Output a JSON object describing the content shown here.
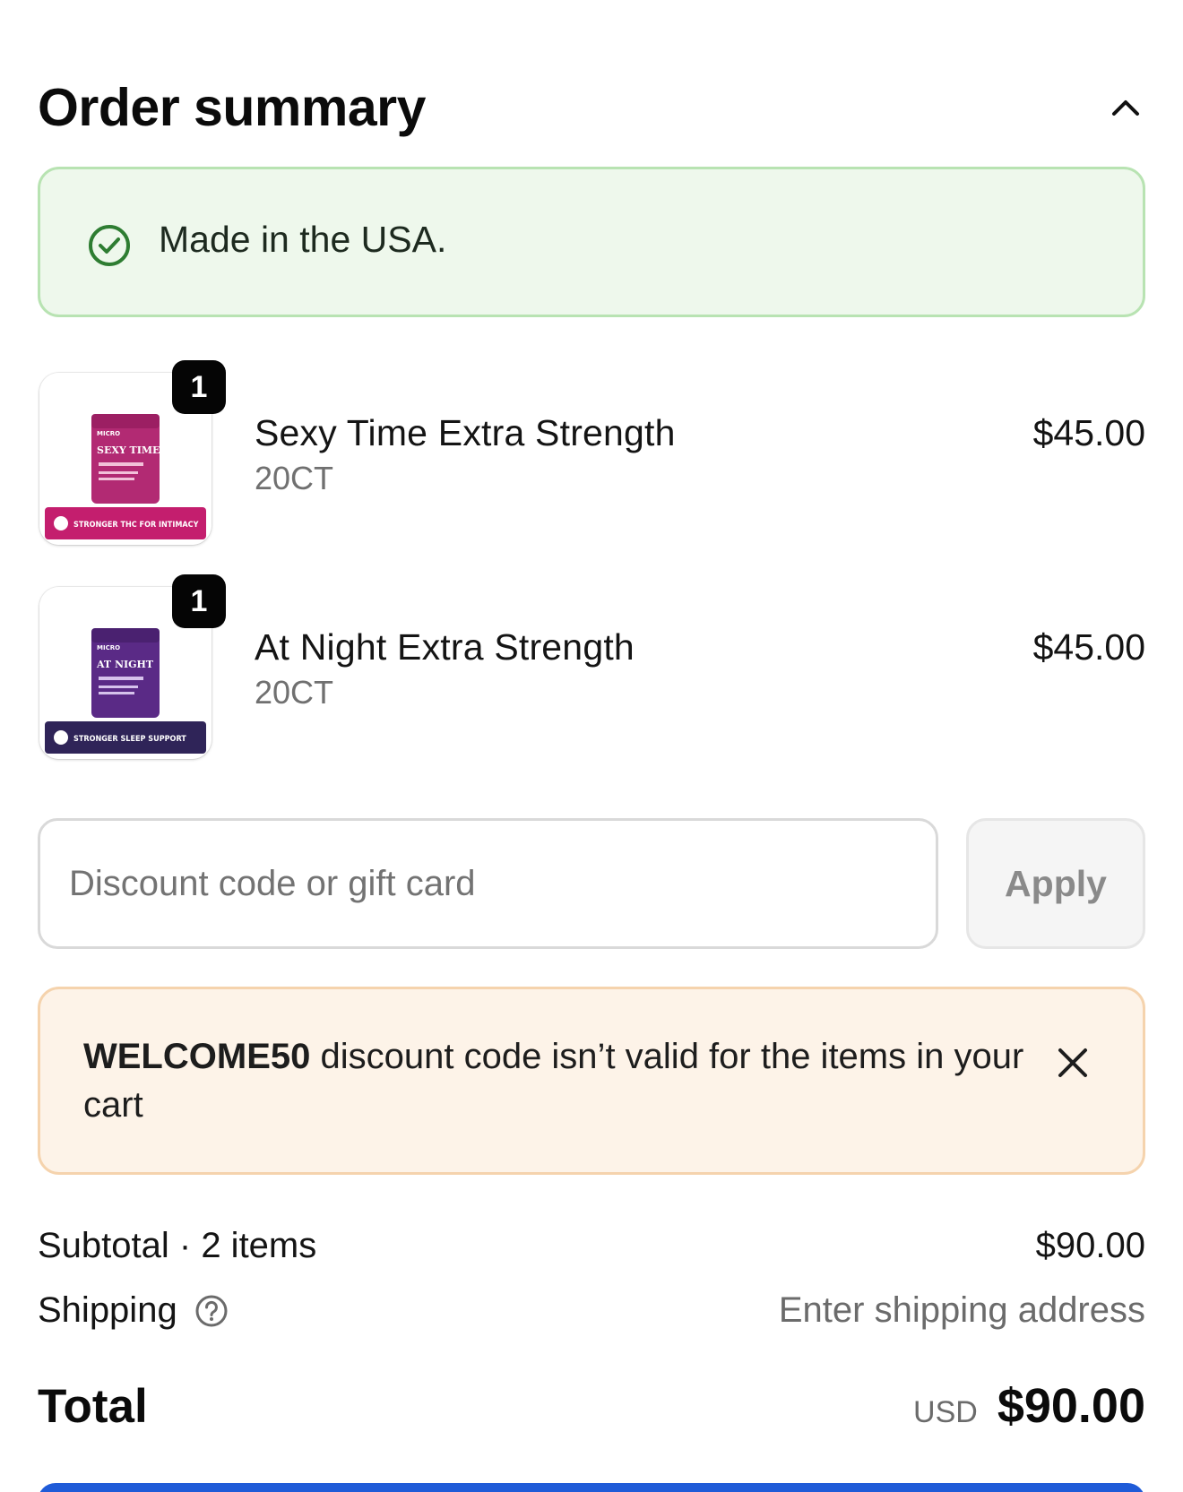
{
  "header": {
    "title": "Order summary",
    "toggle_icon": "chevron-up-icon"
  },
  "banner": {
    "text": "Made in the USA.",
    "icon": "check-circle-icon",
    "colors": {
      "background": "#eef8ec",
      "border": "#b8e3b2",
      "icon": "#2e7d32"
    }
  },
  "items": [
    {
      "quantity": "1",
      "name": "Sexy Time Extra Strength",
      "variant": "20CT",
      "price": "$45.00",
      "image": {
        "pack_color": "#b22a73",
        "band_color": "#c41e6e",
        "pack_title": "SEXY TIME",
        "band_text": "STRONGER THC FOR INTIMACY"
      }
    },
    {
      "quantity": "1",
      "name": "At Night Extra Strength",
      "variant": "20CT",
      "price": "$45.00",
      "image": {
        "pack_color": "#5a2a86",
        "band_color": "#2f2458",
        "pack_title": "AT NIGHT",
        "band_text": "STRONGER SLEEP SUPPORT"
      }
    }
  ],
  "discount": {
    "placeholder": "Discount code or gift card",
    "value": "",
    "apply_label": "Apply"
  },
  "warning": {
    "code": "WELCOME50",
    "message": " discount code isn’t valid for the items in your cart",
    "close_icon": "close-icon",
    "colors": {
      "background": "#fdf3e8",
      "border": "#f5d3ad"
    }
  },
  "summary": {
    "subtotal_label": "Subtotal · 2 items",
    "subtotal_value": "$90.00",
    "shipping_label": "Shipping",
    "shipping_value": "Enter shipping address",
    "help_icon": "question-circle-icon"
  },
  "total": {
    "label": "Total",
    "currency": "USD",
    "value": "$90.00"
  },
  "colors": {
    "primary_button": "#1f5bd8"
  }
}
